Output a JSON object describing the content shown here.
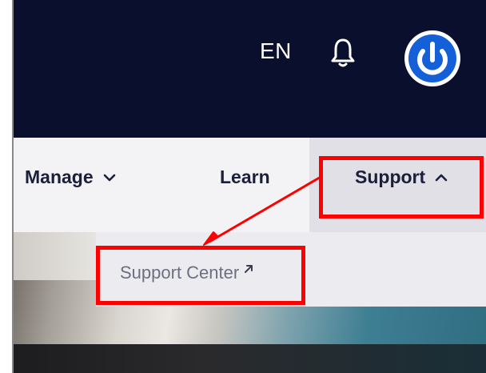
{
  "header": {
    "language": "EN",
    "icons": {
      "notifications": "bell-icon",
      "power": "power-icon"
    }
  },
  "nav": {
    "items": [
      {
        "label": "Manage",
        "chevron": "down"
      },
      {
        "label": "Learn"
      },
      {
        "label": "Support",
        "chevron": "up",
        "expanded": true
      }
    ]
  },
  "dropdown": {
    "items": [
      {
        "label": "Support Center",
        "icon": "external-link-icon"
      }
    ]
  },
  "colors": {
    "header_bg": "#0a0f2d",
    "nav_bg": "#f3f3f5",
    "active_nav_bg": "#e0e0e6",
    "annotation": "#ff0000",
    "power_icon": "#1460d8"
  }
}
